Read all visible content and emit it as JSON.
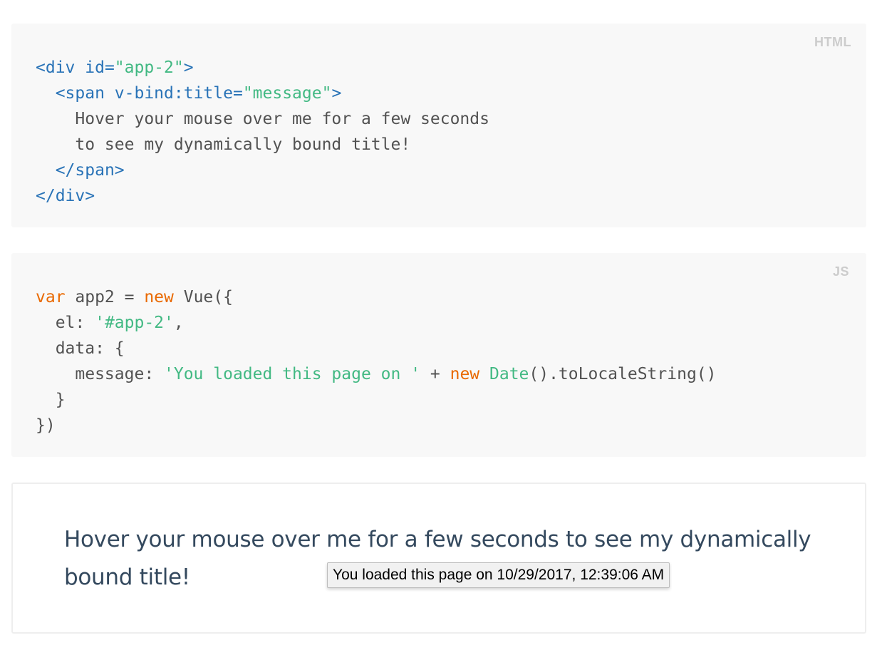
{
  "html_block": {
    "lang": "HTML",
    "lines": {
      "l1_open": "<div ",
      "l1_attr": "id=",
      "l1_val": "\"app-2\"",
      "l1_close": ">",
      "l2_indent": "  ",
      "l2_open": "<span ",
      "l2_attr": "v-bind:title=",
      "l2_val": "\"message\"",
      "l2_close": ">",
      "l3": "    Hover your mouse over me for a few seconds",
      "l4": "    to see my dynamically bound title!",
      "l5_indent": "  ",
      "l5": "</span>",
      "l6": "</div>"
    }
  },
  "js_block": {
    "lang": "JS",
    "lines": {
      "l1_var": "var",
      "l1_mid": " app2 = ",
      "l1_new": "new",
      "l1_end": " Vue({",
      "l2_key": "  el: ",
      "l2_val": "'#app-2'",
      "l2_end": ",",
      "l3": "  data: {",
      "l4_key": "    message: ",
      "l4_str": "'You loaded this page on '",
      "l4_plus": " + ",
      "l4_new": "new",
      "l4_sp": " ",
      "l4_date": "Date",
      "l4_end": "().toLocaleString()",
      "l5": "  }",
      "l6": "})"
    }
  },
  "demo": {
    "text": "Hover your mouse over me for a few seconds to see my dynamically bound title!"
  },
  "tooltip": {
    "text": "You loaded this page on 10/29/2017, 12:39:06 AM"
  }
}
